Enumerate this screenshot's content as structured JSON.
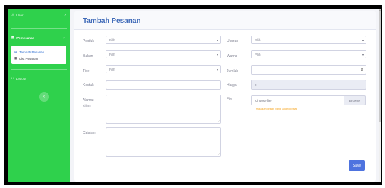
{
  "sidebar": {
    "user_label": "User",
    "pesanan_label": "Pemesanan",
    "submenu": [
      {
        "label": "Tambah Pesanan"
      },
      {
        "label": "List Pesanan"
      }
    ],
    "logout_label": "Logout",
    "toggle_glyph": "‹"
  },
  "page": {
    "title": "Tambah Pesanan"
  },
  "form": {
    "produk": {
      "label": "Produk",
      "value": "Pilih"
    },
    "bahan": {
      "label": "Bahan",
      "value": "Pilih"
    },
    "tipe": {
      "label": "Tipe",
      "value": "Pilih"
    },
    "kontak": {
      "label": "Kontak",
      "value": ""
    },
    "alamat": {
      "label_line1": "Alamat",
      "label_line2": "kirim",
      "value": ""
    },
    "catatan": {
      "label": "Catatan",
      "value": ""
    },
    "ukuran": {
      "label": "Ukuran",
      "value": "Pilih"
    },
    "warna": {
      "label": "Warna",
      "value": "Pilih"
    },
    "jumlah": {
      "label": "Jumlah",
      "value": ""
    },
    "harga": {
      "label": "Harga",
      "value": "0"
    },
    "file": {
      "label": "File",
      "placeholder": "Choose file",
      "browse_label": "Browse",
      "hint": "Masukan design yang sudah di buat"
    },
    "save_label": "Save"
  },
  "colors": {
    "sidebar": "#2fd14c",
    "title": "#3f6ab8",
    "save_button": "#4e73df",
    "hint": "#f6a623"
  },
  "icons": [
    "user-icon",
    "folder-icon",
    "file-icon",
    "list-icon",
    "logout-icon",
    "chevron-right-icon",
    "chevron-down-icon",
    "sidebar-toggle-icon"
  ]
}
